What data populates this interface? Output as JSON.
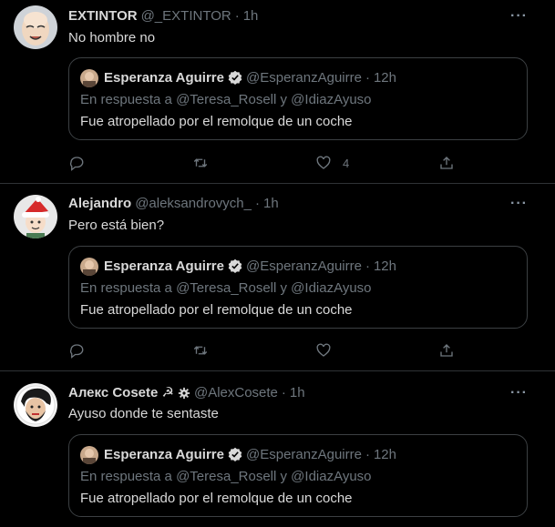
{
  "tweets": [
    {
      "name": "EXTINTOR",
      "handle": "@_EXTINTOR",
      "time": "1h",
      "text": "No hombre no",
      "avatar": "bald-cartoon-avatar",
      "like_count": "4",
      "quote": {
        "name": "Esperanza Aguirre",
        "handle": "@EsperanzAguirre",
        "time": "12h",
        "reply": "En respuesta a @Teresa_Rosell y @IdiazAyuso",
        "text": "Fue atropellado por el remolque de un coche"
      }
    },
    {
      "name": "Alejandro",
      "handle": "@aleksandrovych_",
      "time": "1h",
      "text": "Pero está bien?",
      "avatar": "santa-hat-avatar",
      "like_count": "",
      "quote": {
        "name": "Esperanza Aguirre",
        "handle": "@EsperanzAguirre",
        "time": "12h",
        "reply": "En respuesta a @Teresa_Rosell y @IdiazAyuso",
        "text": "Fue atropellado por el remolque de un coche"
      }
    },
    {
      "name": "Алекс Cosete ☭",
      "handle": "@AlexCosete",
      "time": "1h",
      "text": "Ayuso donde te sentaste",
      "avatar": "che-cartoon-avatar",
      "like_count": "",
      "quote": {
        "name": "Esperanza Aguirre",
        "handle": "@EsperanzAguirre",
        "time": "12h",
        "reply": "En respuesta a @Teresa_Rosell y @IdiazAyuso",
        "text": "Fue atropellado por el remolque de un coche"
      }
    }
  ],
  "ui": {
    "more_label": "···",
    "separator": "·"
  },
  "colors": {
    "background": "#000000",
    "text": "#d9d9d9",
    "muted": "#6e767d",
    "border": "#2f3336",
    "verified": "#d9d9d9"
  },
  "icons": [
    "reply-icon",
    "retweet-icon",
    "like-icon",
    "share-icon",
    "more-icon",
    "verified-icon",
    "settings-icon"
  ]
}
